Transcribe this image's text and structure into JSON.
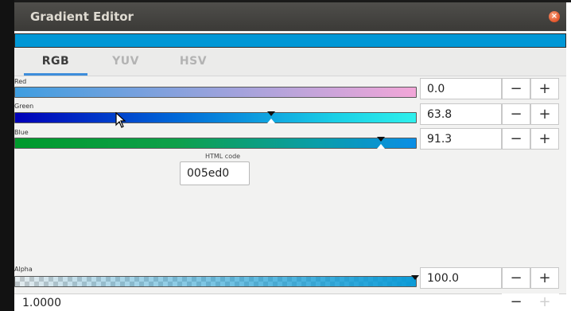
{
  "window": {
    "title": "Gradient Editor",
    "close_icon": "close-icon"
  },
  "preview": {
    "color": "#0097d6"
  },
  "tabs": [
    {
      "label": "RGB",
      "active": true
    },
    {
      "label": "YUV",
      "active": false
    },
    {
      "label": "HSV",
      "active": false
    }
  ],
  "channels": {
    "red": {
      "label": "Red",
      "value": "0.0",
      "fraction": 0.0
    },
    "green": {
      "label": "Green",
      "value": "63.8",
      "fraction": 0.638
    },
    "blue": {
      "label": "Blue",
      "value": "91.3",
      "fraction": 0.913
    }
  },
  "stepper": {
    "minus": "−",
    "plus": "+"
  },
  "html_code": {
    "label": "HTML code",
    "value": "005ed0"
  },
  "alpha": {
    "label": "Alpha",
    "value": "100.0",
    "fraction": 1.0
  },
  "position": {
    "value": "1.0000"
  }
}
